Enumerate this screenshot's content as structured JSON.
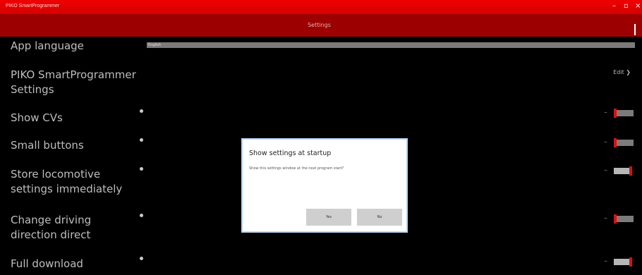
{
  "window": {
    "title": "PIKO SmartProgrammer",
    "minimize": "–",
    "maximize": "▫",
    "close": "×"
  },
  "header": {
    "title": "Settings"
  },
  "settings": {
    "language": {
      "label": "App language",
      "value": "English"
    },
    "piko": {
      "label": "PIKO SmartProgrammer Settings",
      "edit": "Edit ❯"
    },
    "show_cvs": {
      "label": "Show CVs",
      "state": "off"
    },
    "small_buttons": {
      "label": "Small buttons",
      "state": "off"
    },
    "store_settings": {
      "label": "Store locomotive settings immediately",
      "state": "on"
    },
    "change_direction": {
      "label": "Change driving direction direct",
      "state": "off"
    },
    "full_download": {
      "label": "Full download",
      "state": "on"
    }
  },
  "dialog": {
    "title": "Show settings at startup",
    "message": "Show this settings window at the next program start?",
    "yes": "Yes",
    "no": "No"
  },
  "colors": {
    "titlebar": "#e00000",
    "header": "#9d0000",
    "accent": "#ff1010",
    "background": "#000000"
  }
}
